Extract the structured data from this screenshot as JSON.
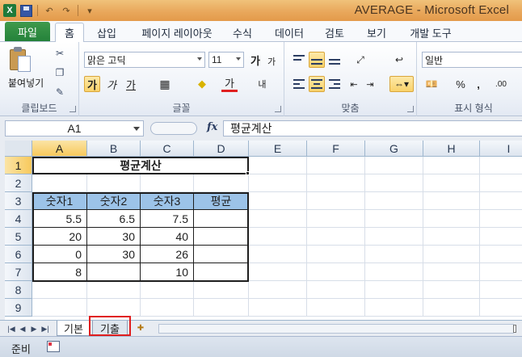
{
  "window": {
    "title": "AVERAGE  -  Microsoft Excel"
  },
  "qat": {
    "app_icon": "X",
    "undo": "↶",
    "redo": "↷",
    "customize": "▾"
  },
  "ribbon_tabs": [
    {
      "label": "파일"
    },
    {
      "label": "홈"
    },
    {
      "label": "삽입"
    },
    {
      "label": "페이지 레이아웃"
    },
    {
      "label": "수식"
    },
    {
      "label": "데이터"
    },
    {
      "label": "검토"
    },
    {
      "label": "보기"
    },
    {
      "label": "개발 도구"
    }
  ],
  "ribbon": {
    "clipboard": {
      "paste_label": "붙여넣기",
      "group_label": "클립보드"
    },
    "font": {
      "font_name": "맑은 고딕",
      "font_size": "11",
      "grow": "가",
      "shrink": "가",
      "bold": "가",
      "italic": "가",
      "underline": "가",
      "font_color_glyph": "가",
      "group_label": "글꼴"
    },
    "alignment": {
      "group_label": "맞춤",
      "wrap_glyph": "내 "
    },
    "number": {
      "format": "일반",
      "percent": "%",
      "comma": ",",
      "group_label": "표시 형식"
    }
  },
  "formula_bar": {
    "name_box": "A1",
    "fx": "fx",
    "formula": "평균계산"
  },
  "sheet": {
    "columns": [
      "A",
      "B",
      "C",
      "D",
      "E",
      "F",
      "G",
      "H",
      "I"
    ],
    "rows": [
      "1",
      "2",
      "3",
      "4",
      "5",
      "6",
      "7",
      "8",
      "9"
    ],
    "title": "평균계산",
    "table_headers": [
      "숫자1",
      "숫자2",
      "숫자3",
      "평균"
    ],
    "table_rows": [
      [
        "5.5",
        "6.5",
        "7.5",
        ""
      ],
      [
        "20",
        "30",
        "40",
        ""
      ],
      [
        "0",
        "30",
        "26",
        ""
      ],
      [
        "8",
        "",
        "10",
        ""
      ]
    ]
  },
  "sheet_tabs": [
    {
      "label": "기본"
    },
    {
      "label": "기출"
    }
  ],
  "status": {
    "ready": "준비"
  },
  "colors": {
    "table_header_fill": "#9cc3e8",
    "highlight_box": "#e01e1e",
    "file_tab": "#2f8c43"
  }
}
